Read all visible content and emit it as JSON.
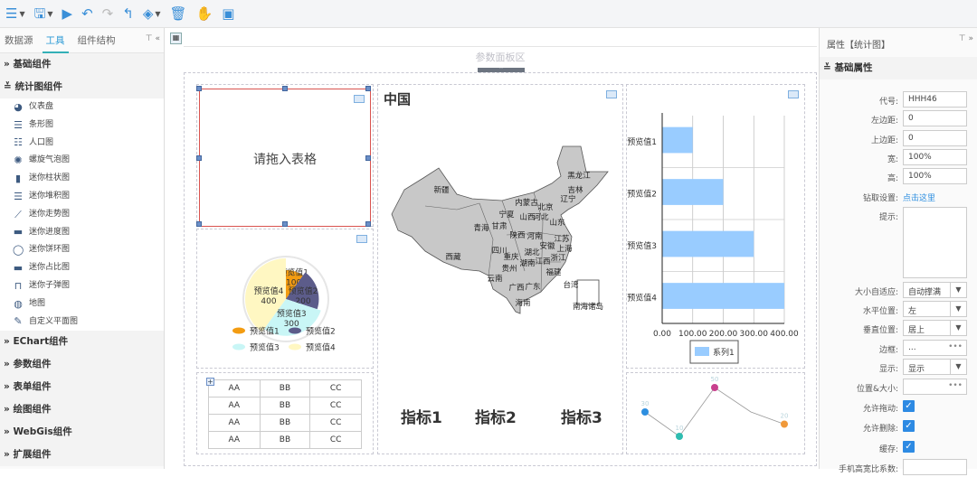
{
  "toolbar": {
    "icons": [
      "menu-icon",
      "save-icon",
      "run-icon",
      "undo-icon",
      "redo-icon",
      "back-icon",
      "paint-icon",
      "delete-icon",
      "hand-icon",
      "window-icon"
    ]
  },
  "left_panel": {
    "tabs": [
      "数据源",
      "工具",
      "组件结构"
    ],
    "active_tab": "工具",
    "sections": [
      {
        "label": "基础组件",
        "expanded": false
      },
      {
        "label": "统计图组件",
        "expanded": true
      }
    ],
    "chart_items": [
      {
        "label": "仪表盘",
        "icon": "gauge-icon"
      },
      {
        "label": "条形图",
        "icon": "bar-chart-icon"
      },
      {
        "label": "人口图",
        "icon": "population-icon"
      },
      {
        "label": "螺旋气泡图",
        "icon": "bubble-icon"
      },
      {
        "label": "迷你柱状图",
        "icon": "column-icon"
      },
      {
        "label": "迷你堆积图",
        "icon": "stack-icon"
      },
      {
        "label": "迷你走势图",
        "icon": "trend-icon"
      },
      {
        "label": "迷你进度图",
        "icon": "progress-icon"
      },
      {
        "label": "迷你饼环图",
        "icon": "ring-icon"
      },
      {
        "label": "迷你占比图",
        "icon": "ratio-icon"
      },
      {
        "label": "迷你子弹图",
        "icon": "bullet-icon"
      },
      {
        "label": "地图",
        "icon": "globe-icon"
      },
      {
        "label": "自定义平面图",
        "icon": "pen-icon"
      }
    ],
    "more_sections": [
      "EChart组件",
      "参数组件",
      "表单组件",
      "绘图组件",
      "WebGis组件",
      "扩展组件"
    ]
  },
  "canvas": {
    "param_panel": "参数面板区",
    "placeholder": "请拖入表格",
    "map_title": "中国",
    "map_regions": [
      [
        "新疆",
        488,
        213
      ],
      [
        "西藏",
        501,
        287
      ],
      [
        "青海",
        532,
        255
      ],
      [
        "甘肃",
        552,
        253
      ],
      [
        "宁夏",
        560,
        240
      ],
      [
        "内蒙古",
        582,
        227
      ],
      [
        "山西",
        583,
        243
      ],
      [
        "河北",
        598,
        243
      ],
      [
        "北京",
        603,
        232
      ],
      [
        "黑龙江",
        640,
        197
      ],
      [
        "吉林",
        636,
        213
      ],
      [
        "辽宁",
        628,
        223
      ],
      [
        "山东",
        616,
        249
      ],
      [
        "陕西",
        572,
        263
      ],
      [
        "河南",
        591,
        264
      ],
      [
        "江苏",
        621,
        267
      ],
      [
        "安徽",
        605,
        275
      ],
      [
        "上海",
        624,
        278
      ],
      [
        "四川",
        552,
        280
      ],
      [
        "重庆",
        565,
        287
      ],
      [
        "湖北",
        588,
        282
      ],
      [
        "浙江",
        617,
        288
      ],
      [
        "湖南",
        583,
        294
      ],
      [
        "江西",
        600,
        292
      ],
      [
        "贵州",
        563,
        300
      ],
      [
        "云南",
        547,
        311
      ],
      [
        "福建",
        612,
        304
      ],
      [
        "广西",
        571,
        321
      ],
      [
        "广东",
        589,
        320
      ],
      [
        "台湾",
        631,
        318
      ],
      [
        "海南",
        578,
        338
      ],
      [
        "南海诸岛",
        650,
        342
      ]
    ],
    "indicators": [
      "指标1",
      "指标2",
      "指标3"
    ],
    "table": [
      [
        "AA",
        "BB",
        "CC"
      ],
      [
        "AA",
        "BB",
        "CC"
      ],
      [
        "AA",
        "BB",
        "CC"
      ],
      [
        "AA",
        "BB",
        "CC"
      ]
    ]
  },
  "chart_data": [
    {
      "type": "pie",
      "categories": [
        "预览值1",
        "预览值2",
        "预览值3",
        "预览值4"
      ],
      "values": [
        100,
        200,
        300,
        400
      ],
      "colors": [
        "#f39c12",
        "#5c5c8a",
        "#c9f6f6",
        "#fff7c2"
      ],
      "legend": "bottom"
    },
    {
      "type": "bar",
      "orientation": "horizontal",
      "categories": [
        "预览值1",
        "预览值2",
        "预览值3",
        "预览值4"
      ],
      "series": [
        {
          "name": "系列1",
          "values": [
            100,
            200,
            300,
            400
          ]
        }
      ],
      "xticks": [
        "0.00",
        "100.00",
        "200.00",
        "300.00",
        "400.00"
      ],
      "xlim": [
        0,
        400
      ],
      "color": "#99ccff",
      "grid": true,
      "legend": "bottom"
    },
    {
      "type": "line",
      "values": [
        30,
        10,
        50,
        30,
        20
      ],
      "labels": [
        "30",
        "10",
        "50",
        "",
        "20"
      ],
      "point_colors": [
        "#2e8fe0",
        "#2fbcb0",
        "#c8408e",
        "",
        "#f0993a"
      ]
    }
  ],
  "right_panel": {
    "title": "属性【统计图】",
    "section": "基础属性",
    "fields": {
      "code": {
        "label": "代号:",
        "value": "HHH46"
      },
      "left": {
        "label": "左边距:",
        "value": "0"
      },
      "top": {
        "label": "上边距:",
        "value": "0"
      },
      "width": {
        "label": "宽:",
        "value": "100%"
      },
      "height": {
        "label": "高:",
        "value": "100%"
      },
      "drill": {
        "label": "钻取设置:",
        "value": "点击这里"
      },
      "tip": {
        "label": "提示:",
        "value": ""
      },
      "fit": {
        "label": "大小自适应:",
        "value": "自动撑满"
      },
      "halign": {
        "label": "水平位置:",
        "value": "左"
      },
      "valign": {
        "label": "垂直位置:",
        "value": "居上"
      },
      "border": {
        "label": "边框:",
        "value": "..."
      },
      "display": {
        "label": "显示:",
        "value": "显示"
      },
      "pos": {
        "label": "位置&大小:",
        "value": ""
      },
      "drag": {
        "label": "允许拖动:",
        "checked": true
      },
      "del": {
        "label": "允许删除:",
        "checked": true
      },
      "cache": {
        "label": "缓存:",
        "checked": true
      },
      "ratio": {
        "label": "手机高宽比系数:",
        "value": ""
      }
    },
    "link_color": "#2e8fe0"
  }
}
